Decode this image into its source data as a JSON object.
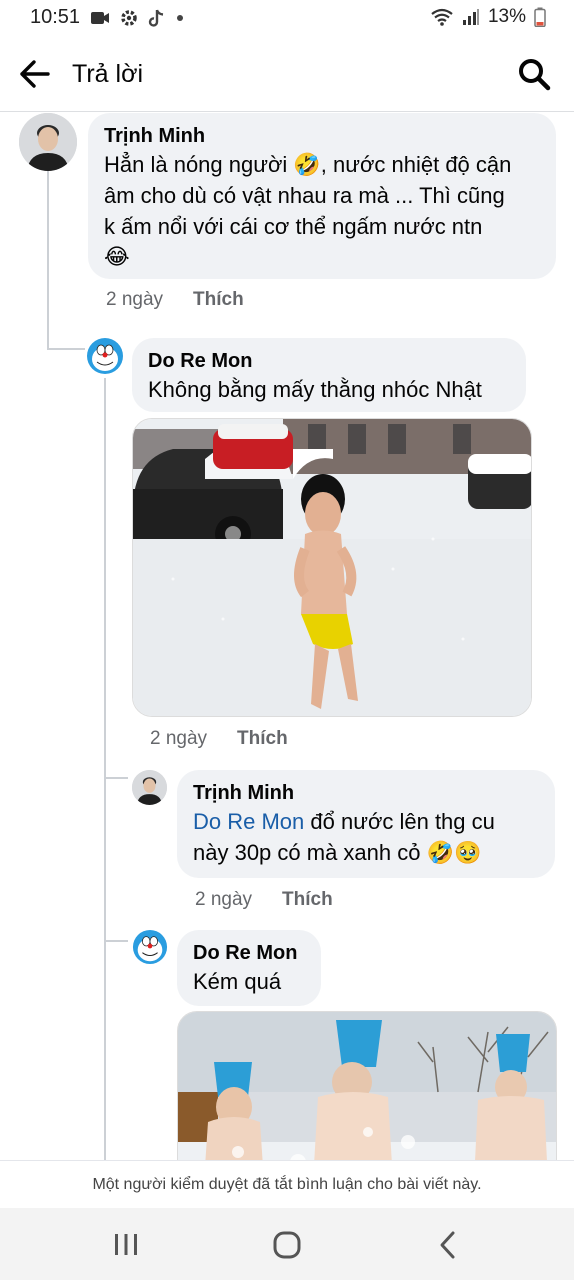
{
  "status": {
    "time": "10:51",
    "battery": "13%",
    "icons": [
      "video-icon",
      "settings-icon",
      "tiktok-icon",
      "dot-icon",
      "wifi-icon",
      "signal-icon",
      "battery-icon"
    ]
  },
  "header": {
    "title": "Trả lời",
    "back_icon": "arrow-left-icon",
    "search_icon": "search-icon"
  },
  "comments": [
    {
      "author": "Trịnh Minh",
      "lines": [
        "Hẳn là nóng người 🤣, nước nhiệt độ cận",
        "âm cho dù có vật nhau ra mà ... Thì cũng",
        "k ấm nổi với cái cơ thể ngấm nước ntn",
        "😂"
      ],
      "time": "2 ngày",
      "like": "Thích"
    },
    {
      "author": "Do Re Mon",
      "lines": [
        "Không bằng mấy thằng nhóc Nhật"
      ],
      "time": "2 ngày",
      "like": "Thích"
    },
    {
      "author": "Trịnh Minh",
      "mention": "Do Re Mon",
      "line1_rest": " đổ nước lên thg cu",
      "line2": "này 30p có mà xanh cỏ 🤣🥹",
      "time": "2 ngày",
      "like": "Thích"
    },
    {
      "author": "Do Re Mon",
      "lines": [
        "Kém quá"
      ]
    }
  ],
  "footer": {
    "disabled_note": "Một người kiểm duyệt đã tắt bình luận cho bài viết này."
  },
  "navigation": {
    "buttons": [
      "recent-apps-icon",
      "home-icon",
      "back-icon"
    ]
  },
  "colors": {
    "bubble": "#f0f2f5",
    "mention": "#1a5ea8",
    "meta_text": "#65676b",
    "thread_line": "#ccd0d5"
  }
}
